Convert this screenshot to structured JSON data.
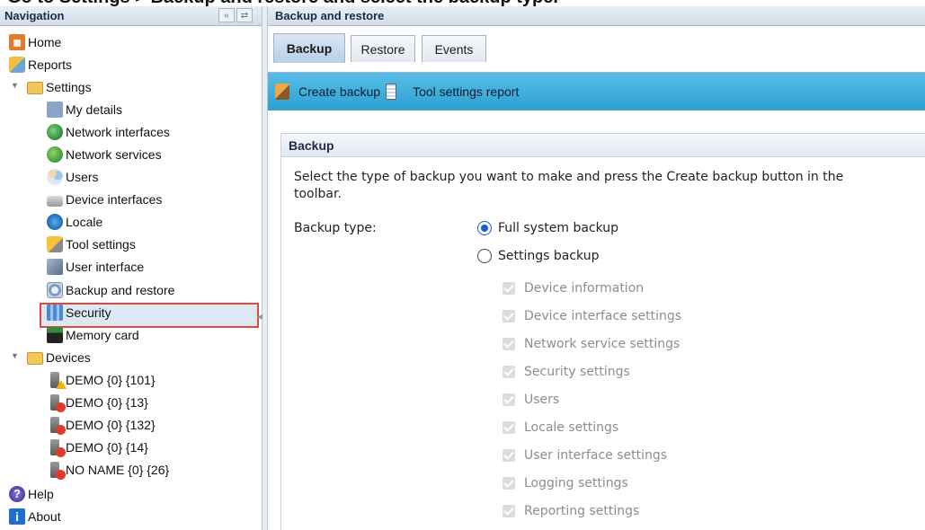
{
  "caption": "Go to Settings > Backup and restore and select the backup type.",
  "nav": {
    "title": "Navigation",
    "items": [
      {
        "label": "Home",
        "icon": "home-icon"
      },
      {
        "label": "Reports",
        "icon": "reports-icon"
      },
      {
        "label": "Settings",
        "icon": "folder-icon"
      },
      {
        "label": "My details",
        "icon": "my-details-icon"
      },
      {
        "label": "Network interfaces",
        "icon": "network-interfaces-icon"
      },
      {
        "label": "Network services",
        "icon": "network-services-icon"
      },
      {
        "label": "Users",
        "icon": "users-icon"
      },
      {
        "label": "Device interfaces",
        "icon": "device-interfaces-icon"
      },
      {
        "label": "Locale",
        "icon": "locale-icon"
      },
      {
        "label": "Tool settings",
        "icon": "tool-settings-icon"
      },
      {
        "label": "User interface",
        "icon": "user-interface-icon"
      },
      {
        "label": "Backup and restore",
        "icon": "backup-restore-icon"
      },
      {
        "label": "Security",
        "icon": "security-icon"
      },
      {
        "label": "Memory card",
        "icon": "memory-card-icon"
      },
      {
        "label": "Devices",
        "icon": "folder-icon"
      },
      {
        "label": "DEMO {0} {101}",
        "icon": "device-warning-icon"
      },
      {
        "label": "DEMO {0} {13}",
        "icon": "device-error-icon"
      },
      {
        "label": "DEMO {0} {132}",
        "icon": "device-error-icon"
      },
      {
        "label": "DEMO {0} {14}",
        "icon": "device-error-icon"
      },
      {
        "label": "NO NAME {0} {26}",
        "icon": "device-error-icon"
      },
      {
        "label": "Help",
        "icon": "help-icon"
      },
      {
        "label": "About",
        "icon": "about-icon"
      }
    ]
  },
  "main": {
    "title": "Backup and restore",
    "tabs": [
      {
        "label": "Backup",
        "active": true
      },
      {
        "label": "Restore",
        "active": false
      },
      {
        "label": "Events",
        "active": false
      }
    ],
    "toolbar": {
      "create_backup": "Create backup",
      "tool_settings_report": "Tool settings report"
    },
    "section": {
      "title": "Backup",
      "description": "Select the type of backup you want to make and press the Create backup button in the toolbar.",
      "backup_type_label": "Backup type:",
      "options": [
        {
          "label": "Full system backup",
          "checked": true
        },
        {
          "label": "Settings backup",
          "checked": false
        }
      ],
      "settings_items": [
        "Device information",
        "Device interface settings",
        "Network service settings",
        "Security settings",
        "Users",
        "Locale settings",
        "User interface settings",
        "Logging settings",
        "Reporting settings"
      ]
    }
  },
  "colors": {
    "toolbar": "#2ea0d2",
    "highlight_border": "#e0493a",
    "selected_bg": "#dde8f5",
    "radio_accent": "#1f5bd8"
  }
}
